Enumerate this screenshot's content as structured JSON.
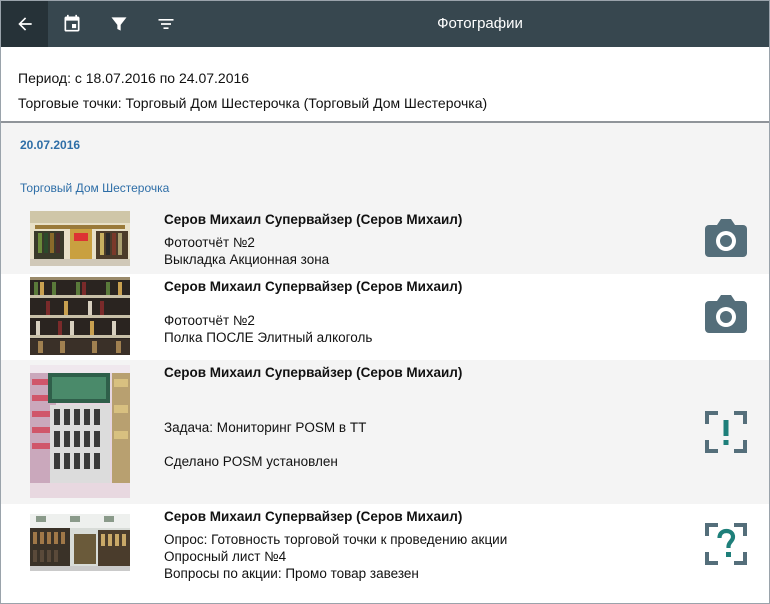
{
  "toolbar": {
    "title": "Фотографии",
    "icons": [
      "back-arrow-icon",
      "calendar-icon",
      "filter-icon",
      "sort-icon"
    ],
    "colors": {
      "bar": "#37474f",
      "active": "#263238"
    }
  },
  "header": {
    "period": "Период: с 18.07.2016 по 24.07.2016",
    "outlets": "Торговые точки: Торговый Дом Шестерочка (Торговый Дом Шестерочка)"
  },
  "date_group": "20.07.2016",
  "store_group": "Торговый Дом Шестерочка",
  "rows": [
    {
      "author": "Серов Михаил Супервайзер (Серов Михаил)",
      "line1": "Фотоотчёт №2",
      "line2": "Выкладка Акционная зона",
      "line3": "",
      "icon": "camera-icon"
    },
    {
      "author": "Серов Михаил Супервайзер (Серов Михаил)",
      "line1": "Фотоотчёт №2",
      "line2": "Полка ПОСЛЕ Элитный алкоголь",
      "line3": "",
      "icon": "camera-icon"
    },
    {
      "author": "Серов Михаил Супервайзер (Серов Михаил)",
      "line1": "Задача: Мониторинг POSM в ТТ",
      "line2": "Сделано POSM установлен",
      "line3": "",
      "icon": "task-exclamation-icon"
    },
    {
      "author": "Серов Михаил Супервайзер (Серов Михаил)",
      "line1": "Опрос: Готовность торговой точки к проведению акции",
      "line2": "Опросный лист №4",
      "line3": "Вопросы по акции: Промо товар завезен",
      "icon": "survey-question-icon"
    }
  ],
  "accent": {
    "label_blue": "#2e6ea7",
    "icon_gray": "#546e7a",
    "icon_teal": "#1e7f7a"
  }
}
